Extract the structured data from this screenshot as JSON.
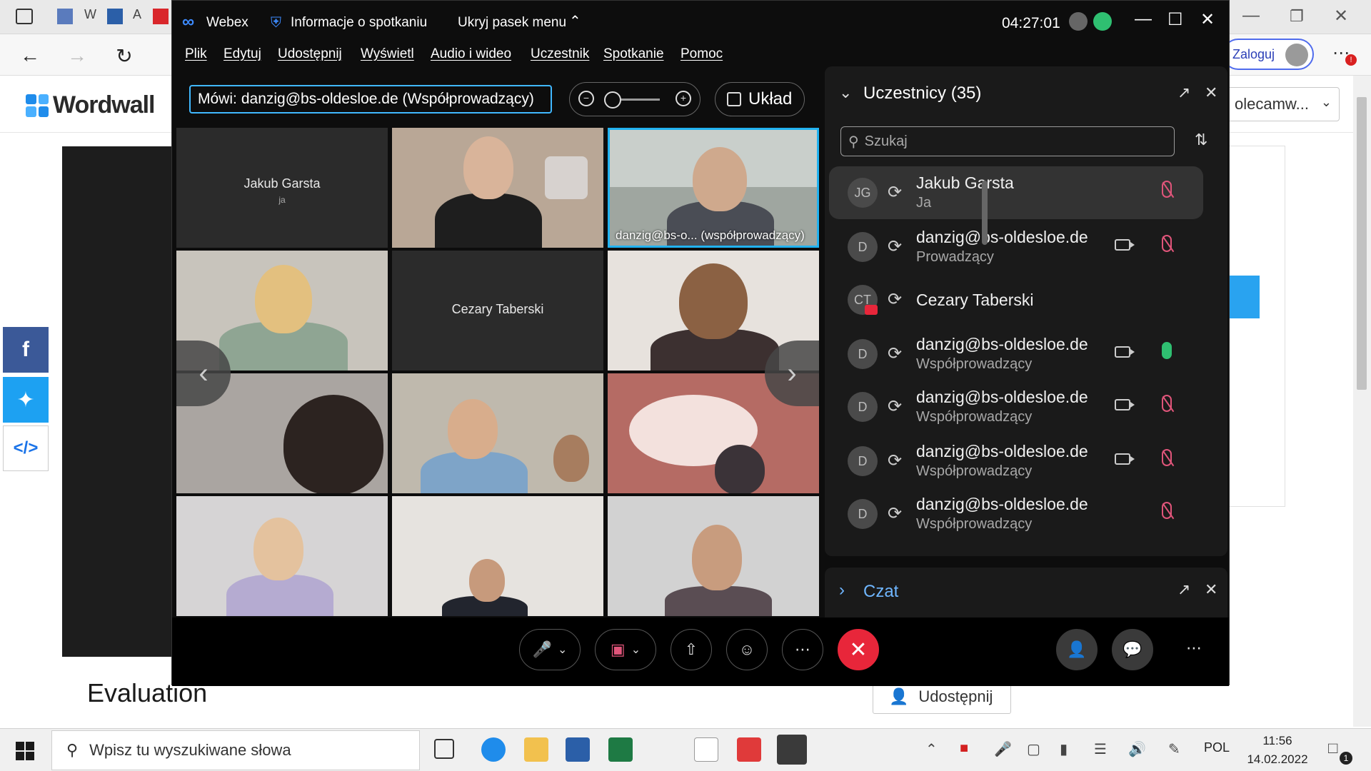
{
  "browser": {
    "tabs": [
      "W",
      "A"
    ],
    "signin_label": "Zaloguj",
    "recommend_label": "olecamw...",
    "logo_text": "Wordwall",
    "eval_title": "Evaluation",
    "share_label": "Udostępnij"
  },
  "webex": {
    "app_name": "Webex",
    "meeting_info": "Informacje o spotkaniu",
    "hide_menu": "Ukryj pasek menu",
    "timer": "04:27:01",
    "menu": [
      "Plik",
      "Edytuj",
      "Udostępnij",
      "Wyświetl",
      "Audio i wideo",
      "Uczestnik",
      "Spotkanie",
      "Pomoc"
    ],
    "speaking_prefix": "Mówi:",
    "speaking_name": "danzig@bs-oldesloe.de (Współprowadzący)",
    "layout_label": "Układ",
    "tiles": {
      "t1_name": "Jakub Garsta",
      "t1_sub": "ja",
      "t3_caption": "danzig@bs-o... (współprowadzący)",
      "t5_name": "Cezary Taberski"
    },
    "participants": {
      "title": "Uczestnicy (35)",
      "search_placeholder": "Szukaj",
      "rows": [
        {
          "initials": "JG",
          "name": "Jakub Garsta",
          "role": "Ja"
        },
        {
          "initials": "D",
          "name": "danzig@bs-oldesloe.de",
          "role": "Prowadzący"
        },
        {
          "initials": "CT",
          "name": "Cezary Taberski",
          "role": ""
        },
        {
          "initials": "D",
          "name": "danzig@bs-oldesloe.de",
          "role": "Współprowadzący"
        },
        {
          "initials": "D",
          "name": "danzig@bs-oldesloe.de",
          "role": "Współprowadzący"
        },
        {
          "initials": "D",
          "name": "danzig@bs-oldesloe.de",
          "role": "Współprowadzący"
        },
        {
          "initials": "D",
          "name": "danzig@bs-oldesloe.de",
          "role": "Współprowadzący"
        }
      ]
    },
    "chat_title": "Czat"
  },
  "taskbar": {
    "search_placeholder": "Wpisz tu wyszukiwane słowa",
    "lang": "POL",
    "time": "11:56",
    "date": "14.02.2022",
    "notif_count": "1"
  }
}
